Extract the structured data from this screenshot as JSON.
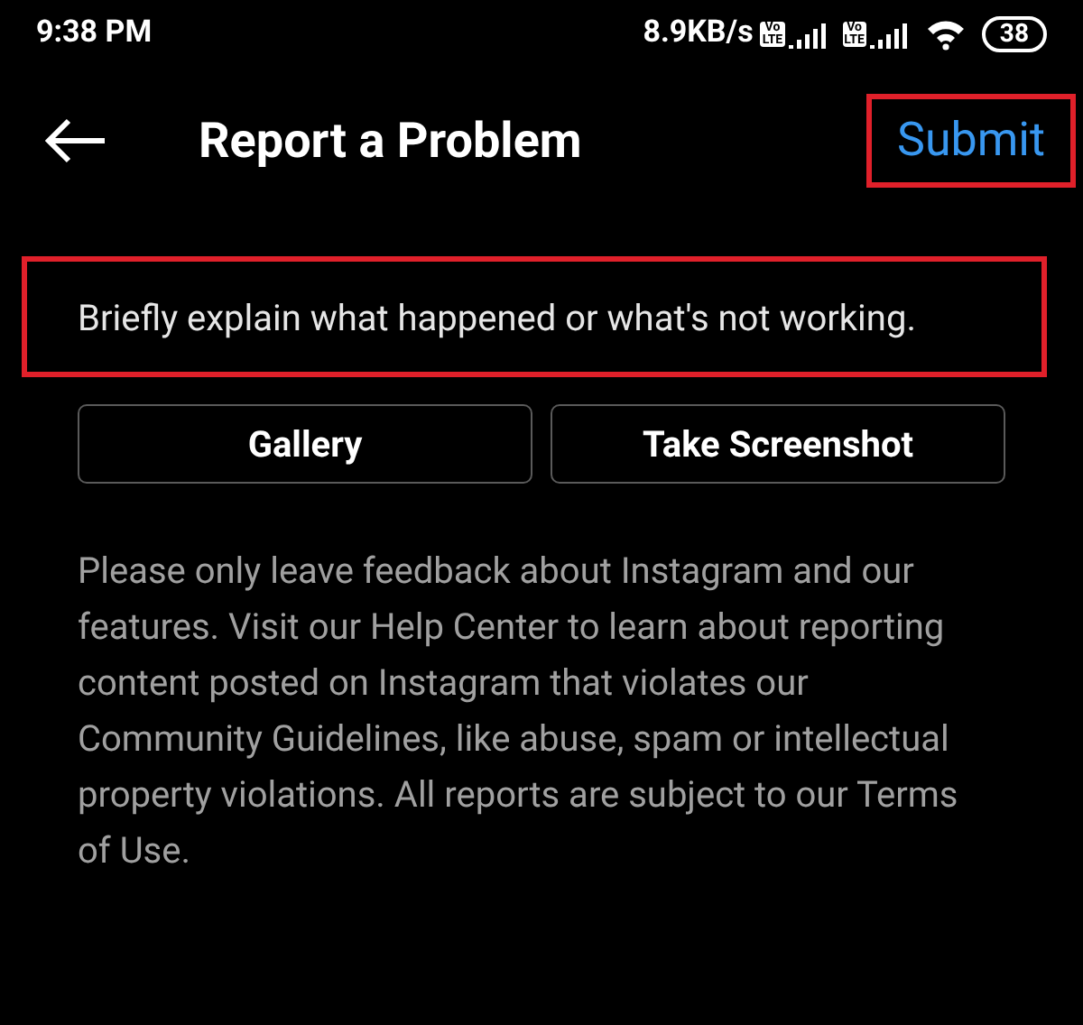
{
  "status_bar": {
    "time": "9:38 PM",
    "speed": "8.9KB/s",
    "sims": [
      {
        "top": "Vo",
        "bottom": "LTE"
      },
      {
        "top": "Vo",
        "bottom": "LTE"
      }
    ],
    "battery": "38"
  },
  "header": {
    "title": "Report a Problem",
    "submit": {
      "label": "Submit",
      "highlighted": true
    }
  },
  "description_field": {
    "placeholder": "Briefly explain what happened or what's not working.",
    "highlighted": true
  },
  "buttons": [
    "Gallery",
    "Take Screenshot"
  ],
  "notice": "Please only leave feedback about Instagram and our features. Visit our Help Center to learn about reporting content posted on Instagram that violates our Community Guidelines, like abuse, spam or intellectual property violations. All reports are subject to our Terms of Use."
}
